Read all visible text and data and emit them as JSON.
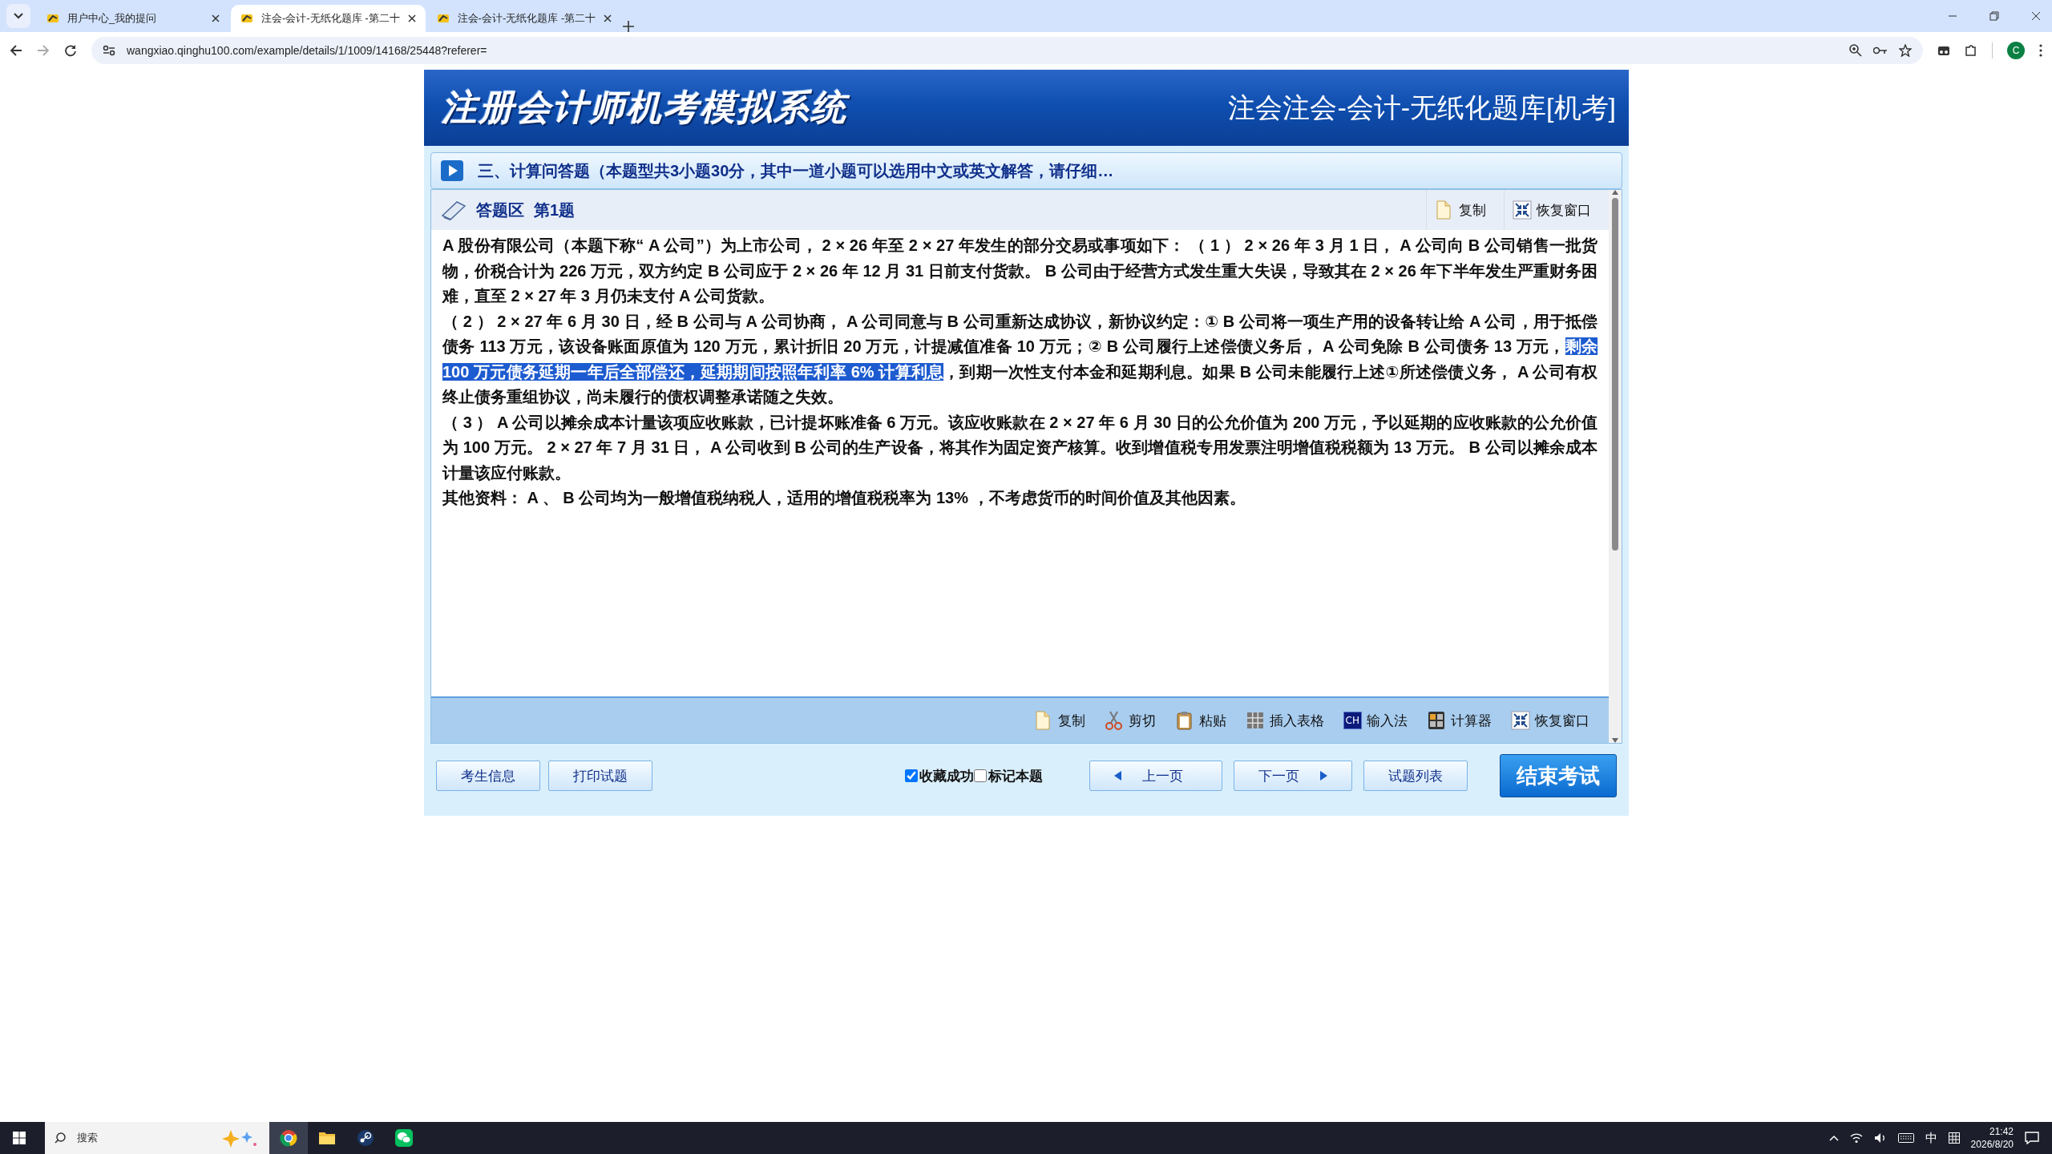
{
  "browser": {
    "tabs": [
      {
        "title": "用户中心_我的提问",
        "selected": false
      },
      {
        "title": "注会-会计-无纸化题库 -第二十",
        "selected": true
      },
      {
        "title": "注会-会计-无纸化题库 -第二十",
        "selected": false
      }
    ],
    "address": "wangxiao.qinghu100.com/example/details/1/1009/14168/25448?referer=",
    "profile_initial": "C"
  },
  "exam": {
    "system_title": "注册会计师机考模拟系统",
    "bank_title": "注会注会-会计-无纸化题库[机考]",
    "section_title": "三、计算问答题（本题型共3小题30分，其中一道小题可以选用中文或英文解答，请仔细…",
    "answer_area": {
      "label": "答题区",
      "number": "第1题",
      "tools": [
        {
          "kind": "copy",
          "label": "复制"
        },
        {
          "kind": "restore",
          "label": "恢复窗口"
        }
      ]
    },
    "paragraphs": [
      [
        {
          "text": "A 股份有限公司（本题下称“ A 公司”）为上市公司， 2 × 26 年至 2 × 27 年发生的部分交易或事项如下： （ 1 ） 2 × 26 年 3 月 1 日， A 公司向 B 公司销售一批货物，价税合计为 226 万元，双方约定 B 公司应于 2 × 26 年 12 月 31 日前支付货款。 B 公司由于经营方式发生重大失误，导致其在 2 × 26 年下半年发生严重财务困难，直至 2 × 27 年 3 月仍未支付 A 公司货款。",
          "selected": false
        }
      ],
      [
        {
          "text": "（ 2 ） 2 × 27 年 6 月 30 日，经 B 公司与 A 公司协商， A 公司同意与 B 公司重新达成协议，新协议约定：① B 公司将一项生产用的设备转让给 A 公司，用于抵偿债务 113 万元，该设备账面原值为 120 万元，累计折旧 20 万元，计提减值准备 10 万元；② B 公司履行上述偿债义务后， A 公司免除 B 公司债务 13 万元，",
          "selected": false
        },
        {
          "text": "剩余 100 万元债务延期一年后全部偿还，延期期间按照年利率 6% 计算利息",
          "selected": true
        },
        {
          "text": "，到期一次性支付本金和延期利息。如果 B 公司未能履行上述①所述偿债义务， A 公司有权终止债务重组协议，尚未履行的债权调整承诺随之失效。",
          "selected": false
        }
      ],
      [
        {
          "text": "（ 3 ） A 公司以摊余成本计量该项应收账款，已计提坏账准备 6 万元。该应收账款在 2 × 27 年 6 月 30 日的公允价值为 200 万元，予以延期的应收账款的公允价值为 100 万元。 2 × 27 年 7 月 31 日， A 公司收到 B 公司的生产设备，将其作为固定资产核算。收到增值税专用发票注明增值税税额为 13 万元。 B 公司以摊余成本计量该应付账款。",
          "selected": false
        }
      ],
      [
        {
          "text": "其他资料： A 、 B 公司均为一般增值税纳税人，适用的增值税税率为 13% ，不考虑货币的时间价值及其他因素。",
          "selected": false
        }
      ]
    ],
    "editor_tools": [
      {
        "kind": "copy",
        "label": "复制"
      },
      {
        "kind": "cut",
        "label": "剪切"
      },
      {
        "kind": "paste",
        "label": "粘贴"
      },
      {
        "kind": "table",
        "label": "插入表格"
      },
      {
        "kind": "ime",
        "label": "输入法",
        "badge": "CH"
      },
      {
        "kind": "calculator",
        "label": "计算器"
      },
      {
        "kind": "restore",
        "label": "恢复窗口"
      }
    ],
    "left_buttons": [
      "考生信息",
      "打印试题"
    ],
    "checks": [
      {
        "label": "收藏成功",
        "checked": true
      },
      {
        "label": "标记本题",
        "checked": false
      }
    ],
    "nav_buttons": [
      {
        "kind": "prev",
        "label": "上一页"
      },
      {
        "kind": "next",
        "label": "下一页"
      },
      {
        "kind": "plain",
        "label": "试题列表"
      }
    ],
    "finish_button": "结束考试"
  },
  "taskbar": {
    "search_placeholder": "搜索",
    "ime": "中",
    "time": "21:42",
    "date": "2026/8/20"
  }
}
